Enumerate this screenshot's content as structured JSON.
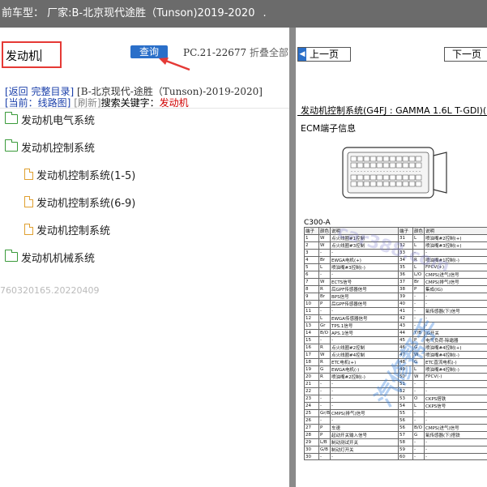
{
  "topbar": {
    "text": "前车型：  厂家:B-北京现代途胜（Tunson)2019-2020",
    "dot": "."
  },
  "search": {
    "value": "发动机",
    "button": "查询",
    "pc_code": "PC.21-22677",
    "fold_label": "折叠全部"
  },
  "links": {
    "back": "[返回",
    "full_catalog": "完整目录]",
    "model": "[B-北京现代-途胜（Tunson)-2019-2020]"
  },
  "info": {
    "current": "[当前：线路图]",
    "refresh": "[刷新]",
    "keyword_label": "搜索关键字：",
    "keyword": "发动机"
  },
  "tree": [
    {
      "label": "发动机电气系统",
      "type": "folder"
    },
    {
      "label": "发动机控制系统",
      "type": "folder"
    },
    {
      "label": "发动机控制系统(1-5)",
      "type": "file"
    },
    {
      "label": "发动机控制系统(6-9)",
      "type": "file"
    },
    {
      "label": "发动机控制系统",
      "type": "file"
    },
    {
      "label": "发动机机械系统",
      "type": "folder"
    }
  ],
  "version": "760320165.20220409",
  "viewer": {
    "prev": "上一页",
    "next": "下一页",
    "doc_title": "发动机控制系统(G4FJ : GAMMA 1.6L T-GDI)(1",
    "ecm_label": "ECM端子信息",
    "connector_ref": "C300-A",
    "table_header": [
      "端子",
      "颜色",
      "说明",
      "端子",
      "颜色",
      "说明"
    ],
    "rows": [
      [
        "1",
        "W",
        "点火线圈#1控制",
        "31",
        "L",
        "喷油嘴#2控制(+)"
      ],
      [
        "2",
        "W",
        "点火线圈#3控制",
        "32",
        "L",
        "喷油嘴#3控制(+)"
      ],
      [
        "3",
        "-",
        "-",
        "33",
        "-",
        "-"
      ],
      [
        "4",
        "Br",
        "EWGA电机(+)",
        "34",
        "R",
        "喷油嘴#1控制(-)"
      ],
      [
        "5",
        "L",
        "喷油嘴#3控制(-)",
        "35",
        "L",
        "FPCV(+)"
      ],
      [
        "6",
        "-",
        "-",
        "36",
        "L/O",
        "CMPS(进气)信号"
      ],
      [
        "7",
        "W",
        "ECTS信号",
        "37",
        "Br",
        "CMPS(排气)信号"
      ],
      [
        "8",
        "R",
        "后GPF传感器信号",
        "38",
        "P",
        "集成(IG)"
      ],
      [
        "9",
        "Br",
        "BPS信号",
        "39",
        "-",
        "-"
      ],
      [
        "10",
        "P",
        "后GPF传感器信号",
        "40",
        "-",
        "-"
      ],
      [
        "11",
        "-",
        "-",
        "41",
        "-",
        "氧传感器(下)信号"
      ],
      [
        "12",
        "L",
        "EWGA传感器信号",
        "42",
        "-",
        "-"
      ],
      [
        "13",
        "Gr",
        "TPS.1信号",
        "43",
        "-",
        "-"
      ],
      [
        "14",
        "B/O",
        "APS.1信号",
        "44",
        "Y/B",
        "IG开关"
      ],
      [
        "15",
        "-",
        "-",
        "45",
        "P",
        "电气负荷-除霜器"
      ],
      [
        "16",
        "R",
        "点火线圈#2控制",
        "46",
        "G",
        "喷油嘴#4控制(+)"
      ],
      [
        "17",
        "W",
        "点火线圈#4控制",
        "47",
        "W",
        "喷油嘴#4控制(-)"
      ],
      [
        "18",
        "R",
        "ETC电机(+)",
        "48",
        "G",
        "ETC直流电机(-)"
      ],
      [
        "19",
        "G",
        "EWGA电机(-)",
        "49",
        "L",
        "喷油嘴#4控制(-)"
      ],
      [
        "20",
        "R",
        "喷油嘴#2控制(-)",
        "50",
        "W",
        "FPCV(-)"
      ],
      [
        "21",
        "-",
        "-",
        "51",
        "-",
        "-"
      ],
      [
        "22",
        "-",
        "-",
        "52",
        "-",
        "-"
      ],
      [
        "23",
        "-",
        "-",
        "53",
        "O",
        "CKPS搭铁"
      ],
      [
        "24",
        "-",
        "-",
        "54",
        "L",
        "CKPS信号"
      ],
      [
        "25",
        "Gr/B",
        "CMPS(排气)信号",
        "55",
        "-",
        "-"
      ],
      [
        "26",
        "-",
        "-",
        "56",
        "-",
        "-"
      ],
      [
        "27",
        "P",
        "车速",
        "56",
        "B/O",
        "CMPS(进气)信号"
      ],
      [
        "28",
        "P",
        "起动开关输入信号",
        "57",
        "G",
        "氧传感器(下)搭铁"
      ],
      [
        "29",
        "L/B",
        "制动测试开关",
        "58",
        "-",
        "-"
      ],
      [
        "30",
        "G/B",
        "制动灯开关",
        "59",
        "-",
        "-"
      ],
      [
        "30",
        "-",
        "-",
        "60",
        "-",
        "-"
      ]
    ],
    "watermark_site": "car388.com",
    "watermark_text": "汽修帮手"
  }
}
